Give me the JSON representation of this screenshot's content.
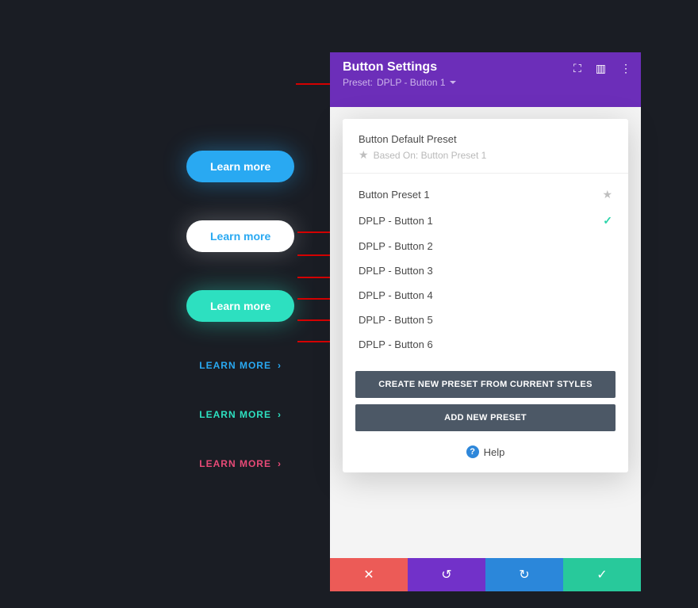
{
  "preview": {
    "btn1": "Learn more",
    "btn2": "Learn more",
    "btn3": "Learn more",
    "link4": "LEARN MORE",
    "link5": "LEARN MORE",
    "link6": "LEARN MORE"
  },
  "panel": {
    "title": "Button Settings",
    "preset_label": "Preset:",
    "preset_value": "DPLP - Button 1"
  },
  "dropdown": {
    "default_title": "Button Default Preset",
    "based_on": "Based On: Button Preset 1",
    "items": [
      {
        "label": "Button Preset 1",
        "starred": true,
        "selected": false
      },
      {
        "label": "DPLP - Button 1",
        "starred": false,
        "selected": true
      },
      {
        "label": "DPLP - Button 2",
        "starred": false,
        "selected": false
      },
      {
        "label": "DPLP - Button 3",
        "starred": false,
        "selected": false
      },
      {
        "label": "DPLP - Button 4",
        "starred": false,
        "selected": false
      },
      {
        "label": "DPLP - Button 5",
        "starred": false,
        "selected": false
      },
      {
        "label": "DPLP - Button 6",
        "starred": false,
        "selected": false
      }
    ],
    "create_btn": "CREATE NEW PRESET FROM CURRENT STYLES",
    "add_btn": "ADD NEW PRESET",
    "help": "Help"
  }
}
